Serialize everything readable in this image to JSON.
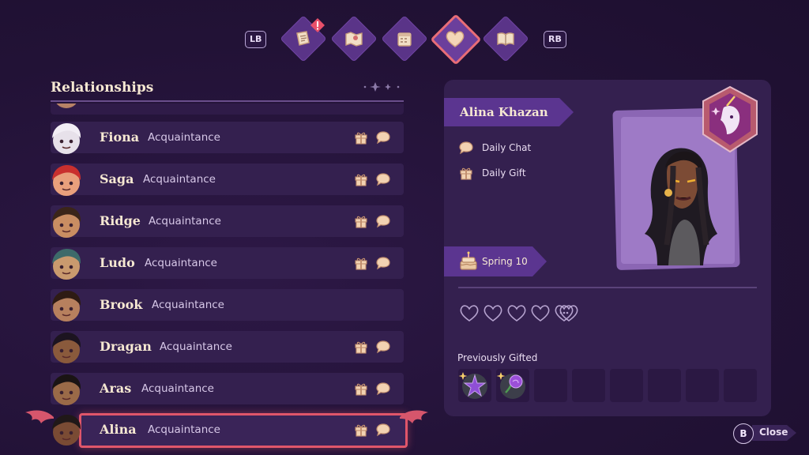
{
  "shoulders": {
    "left": "LB",
    "right": "RB"
  },
  "tabs": [
    {
      "icon": "quest-scroll-icon",
      "alert": true
    },
    {
      "icon": "map-icon",
      "alert": false
    },
    {
      "icon": "calendar-icon",
      "alert": false
    },
    {
      "icon": "heart-icon",
      "alert": false,
      "active": true
    },
    {
      "icon": "journal-book-icon",
      "alert": false
    }
  ],
  "relationships": {
    "title": "Relationships",
    "rows": [
      {
        "name": "Fiona",
        "status": "Acquaintance",
        "gift": true,
        "chat": true,
        "avatar_color": "#e7e1ea",
        "hair": "#f2eef5"
      },
      {
        "name": "Saga",
        "status": "Acquaintance",
        "gift": true,
        "chat": true,
        "avatar_color": "#e9a07c",
        "hair": "#c9302e"
      },
      {
        "name": "Ridge",
        "status": "Acquaintance",
        "gift": true,
        "chat": true,
        "avatar_color": "#c98d62",
        "hair": "#3b2519"
      },
      {
        "name": "Ludo",
        "status": "Acquaintance",
        "gift": true,
        "chat": true,
        "avatar_color": "#c99a6e",
        "hair": "#3d6a6a"
      },
      {
        "name": "Brook",
        "status": "Acquaintance",
        "gift": false,
        "chat": false,
        "avatar_color": "#b7805e",
        "hair": "#2e1b14"
      },
      {
        "name": "Dragan",
        "status": "Acquaintance",
        "gift": true,
        "chat": true,
        "avatar_color": "#8a5a3c",
        "hair": "#1c1420"
      },
      {
        "name": "Aras",
        "status": "Acquaintance",
        "gift": true,
        "chat": true,
        "avatar_color": "#9a6a48",
        "hair": "#1a1414"
      },
      {
        "name": "Alina",
        "status": "Acquaintance",
        "gift": true,
        "chat": true,
        "avatar_color": "#7a4b34",
        "hair": "#201818",
        "selected": true
      }
    ]
  },
  "detail": {
    "name": "Alina Khazan",
    "tasks": [
      {
        "icon": "chat-bubble-icon",
        "label": "Daily Chat"
      },
      {
        "icon": "gift-icon",
        "label": "Daily Gift"
      }
    ],
    "birthday": "Spring 10",
    "hearts": {
      "filled": 0,
      "total": 5
    },
    "previously_gifted_label": "Previously Gifted",
    "gifted_items": [
      "purple-flower-icon",
      "violet-rose-icon"
    ],
    "empty_slots": 6
  },
  "close": {
    "button": "B",
    "label": "Close"
  },
  "colors": {
    "accent": "#e0566a",
    "panel": "#34204f",
    "cream": "#f6e8d2"
  }
}
